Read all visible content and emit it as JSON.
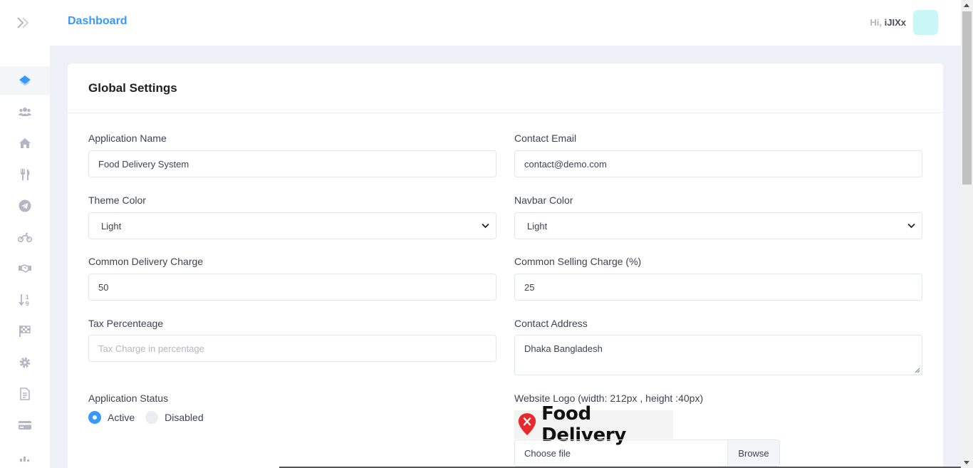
{
  "header": {
    "breadcrumb": "Dashboard",
    "greeting_prefix": "Hi,",
    "username": "iJIXx"
  },
  "sidebar": {
    "items": [
      {
        "icon": "layers-icon",
        "active": true
      },
      {
        "icon": "users-icon"
      },
      {
        "icon": "home-icon"
      },
      {
        "icon": "utensils-icon"
      },
      {
        "icon": "telegram-icon"
      },
      {
        "icon": "motorcycle-icon"
      },
      {
        "icon": "handshake-icon"
      },
      {
        "icon": "sort-icon"
      },
      {
        "icon": "flag-checkered-icon"
      },
      {
        "icon": "gear-icon"
      },
      {
        "icon": "file-icon"
      },
      {
        "icon": "credit-card-icon"
      },
      {
        "icon": "chart-icon"
      }
    ]
  },
  "card": {
    "title": "Global Settings"
  },
  "form": {
    "app_name": {
      "label": "Application Name",
      "value": "Food Delivery System"
    },
    "contact_email": {
      "label": "Contact Email",
      "value": "contact@demo.com"
    },
    "theme_color": {
      "label": "Theme Color",
      "value": "Light"
    },
    "navbar_color": {
      "label": "Navbar Color",
      "value": "Light"
    },
    "delivery_charge": {
      "label": "Common Delivery Charge",
      "value": "50"
    },
    "selling_charge": {
      "label": "Common Selling Charge (%)",
      "value": "25"
    },
    "tax": {
      "label": "Tax Percenteage",
      "placeholder": "Tax Charge in percentage"
    },
    "address": {
      "label": "Contact Address",
      "value": "Dhaka Bangladesh"
    },
    "status": {
      "label": "Application Status",
      "options": [
        "Active",
        "Disabled"
      ],
      "selected": "Active"
    },
    "logo": {
      "label": "Website Logo (width: 212px , height :40px)",
      "brand_text": "Food Delivery",
      "file_placeholder": "Choose file",
      "browse_label": "Browse"
    }
  },
  "colors": {
    "accent": "#3699ff",
    "avatar_bg": "#c9f7f5"
  }
}
